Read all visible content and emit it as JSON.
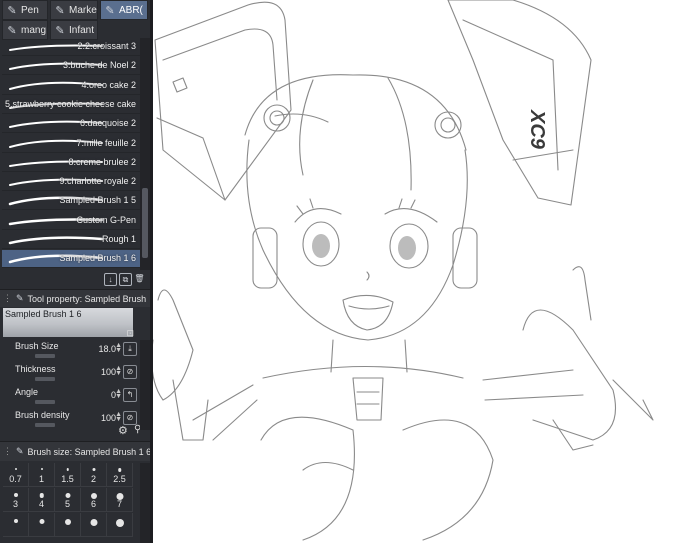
{
  "tabs_row1": [
    {
      "label": "Pen",
      "icon": "pen-icon",
      "active": false
    },
    {
      "label": "Marke",
      "icon": "marker-icon",
      "active": false
    },
    {
      "label": "ABR(",
      "icon": "brush-icon",
      "active": true
    }
  ],
  "tabs_row2": [
    {
      "label": "mang",
      "icon": "pen-icon",
      "active": false
    },
    {
      "label": "Infant",
      "icon": "pen-icon",
      "active": false
    }
  ],
  "brushes": [
    {
      "label": "2.2.croissant 3",
      "selected": false
    },
    {
      "label": "3.buche de Noel 2",
      "selected": false
    },
    {
      "label": "4.oreo cake 2",
      "selected": false
    },
    {
      "label": "5.strawberry cookie cheese cake",
      "selected": false
    },
    {
      "label": "6.dacquoise 2",
      "selected": false
    },
    {
      "label": "7.mille feuille 2",
      "selected": false
    },
    {
      "label": "8.creme brulee 2",
      "selected": false
    },
    {
      "label": "9.charlotte royale 2",
      "selected": false
    },
    {
      "label": "Sampled Brush 1 5",
      "selected": false
    },
    {
      "label": "Custom G-Pen",
      "selected": false
    },
    {
      "label": "Rough 1",
      "selected": false
    },
    {
      "label": "Sampled Brush 1 6",
      "selected": true
    }
  ],
  "tool_property": {
    "title": "Tool property: Sampled Brush",
    "preview_label": "Sampled Brush 1 6",
    "rows": [
      {
        "label": "Brush Size",
        "value": "18.0",
        "fill": 0.5,
        "button": "⤓"
      },
      {
        "label": "Thickness",
        "value": "100",
        "fill": 1.0,
        "button": "⊘"
      },
      {
        "label": "Angle",
        "value": "0",
        "fill": 0.0,
        "button": "↰"
      },
      {
        "label": "Brush density",
        "value": "100",
        "fill": 1.0,
        "button": "⊘"
      }
    ]
  },
  "brush_size": {
    "title": "Brush size: Sampled Brush 1 6",
    "values": [
      "0.7",
      "1",
      "1.5",
      "2",
      "2.5",
      "3",
      "4",
      "5",
      "6",
      "7",
      "",
      "",
      "",
      "",
      ""
    ]
  },
  "colors": {
    "panel": "#2b2d32",
    "selected": "#4d6385",
    "active_tab": "#5a6f8f",
    "sketch": "#8a8a8a"
  }
}
